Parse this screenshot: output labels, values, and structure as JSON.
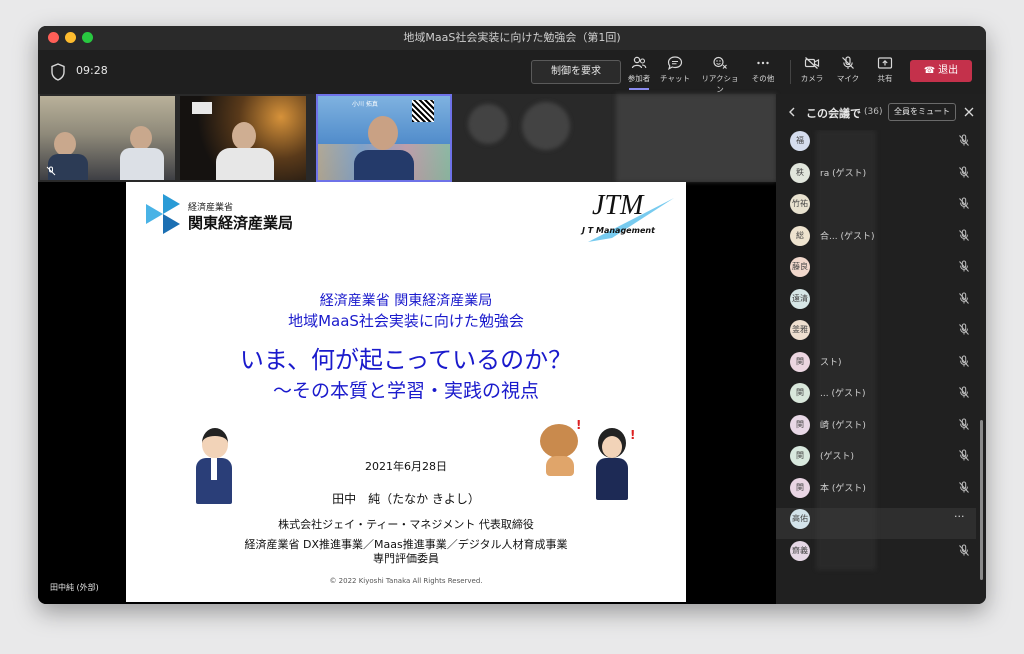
{
  "window": {
    "title": "地域MaaS社会実装に向けた勉強会（第1回)"
  },
  "toolbar": {
    "time": "09:28",
    "request_control": "制御を要求",
    "tools": [
      {
        "icon": "participants-icon",
        "label": "参加者"
      },
      {
        "icon": "chat-icon",
        "label": "チャット"
      },
      {
        "icon": "reactions-icon",
        "label": "リアクション"
      },
      {
        "icon": "more-icon",
        "label": "その他"
      },
      {
        "icon": "camera-off-icon",
        "label": "カメラ"
      },
      {
        "icon": "mic-off-icon",
        "label": "マイク"
      },
      {
        "icon": "share-icon",
        "label": "共有"
      }
    ],
    "leave": "退出"
  },
  "stage": {
    "presenter_label": "田中純 (外部)",
    "tile3_name": "小川 拓真"
  },
  "slide": {
    "org_small": "経済産業省",
    "org_large": "関東経済産業局",
    "logo_main": "JTM",
    "logo_sub": "J T Management",
    "line1": "経済産業省 関東経済産業局",
    "line2": "地域MaaS社会実装に向けた勉強会",
    "title": "いま、何が起こっているのか？",
    "subtitle": "～その本質と学習・実践の視点",
    "date": "2021年6月28日",
    "speaker": "田中　純（たなか きよし）",
    "company": "株式会社ジェイ・ティー・マネジメント 代表取締役",
    "roles": "経済産業省 DX推進事業／Maas推進事業／デジタル人材育成事業",
    "roles2": "専門評価委員",
    "copyright": "© 2022 Kiyoshi Tanaka All Rights Reserved."
  },
  "sidebar": {
    "title": "この会議で",
    "count": "(36)",
    "mute_all": "全員をミュート",
    "participants": [
      {
        "initials": "福",
        "name": ""
      },
      {
        "initials": "秩",
        "name": "ra (ゲスト)"
      },
      {
        "initials": "竹祐",
        "name": ""
      },
      {
        "initials": "総",
        "name": "合... (ゲスト)"
      },
      {
        "initials": "藤良",
        "name": ""
      },
      {
        "initials": "遠清",
        "name": ""
      },
      {
        "initials": "釜雅",
        "name": ""
      },
      {
        "initials": "関",
        "name": "スト)"
      },
      {
        "initials": "関",
        "name": "... (ゲスト)"
      },
      {
        "initials": "関",
        "name": "崎 (ゲスト)"
      },
      {
        "initials": "関",
        "name": "(ゲスト)"
      },
      {
        "initials": "関",
        "name": "本 (ゲスト)"
      },
      {
        "initials": "高佑",
        "name": ""
      },
      {
        "initials": "齋義",
        "name": ""
      }
    ]
  },
  "colors": {
    "accent": "#8b8cf0",
    "leave": "#c4314b",
    "slide_blue": "#1a1acc"
  }
}
